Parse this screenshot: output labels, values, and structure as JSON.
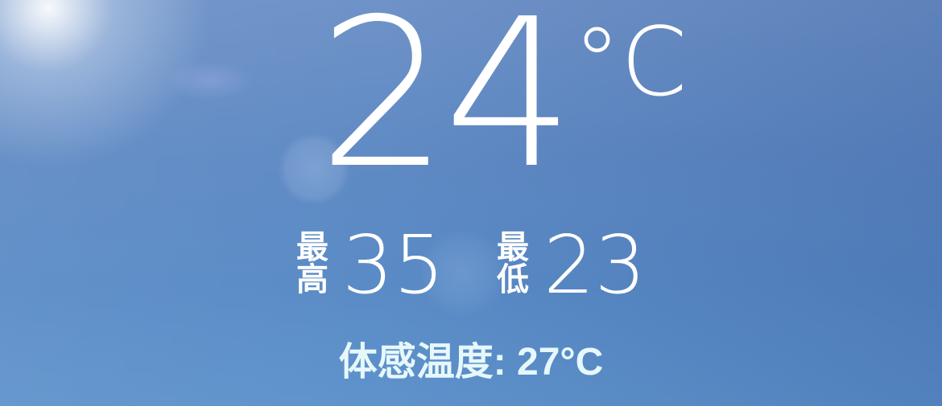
{
  "current": {
    "temperature": "24",
    "unit": "°C"
  },
  "high": {
    "label": "最高",
    "value": "35"
  },
  "low": {
    "label": "最低",
    "value": "23"
  },
  "feels_like": {
    "text": "体感温度: 27°C"
  },
  "colors": {
    "sky": "#5f8ac4",
    "text": "#ffffff",
    "feels_text": "#e6f8fb"
  },
  "icons": {
    "sun": "sun-glare-icon"
  }
}
